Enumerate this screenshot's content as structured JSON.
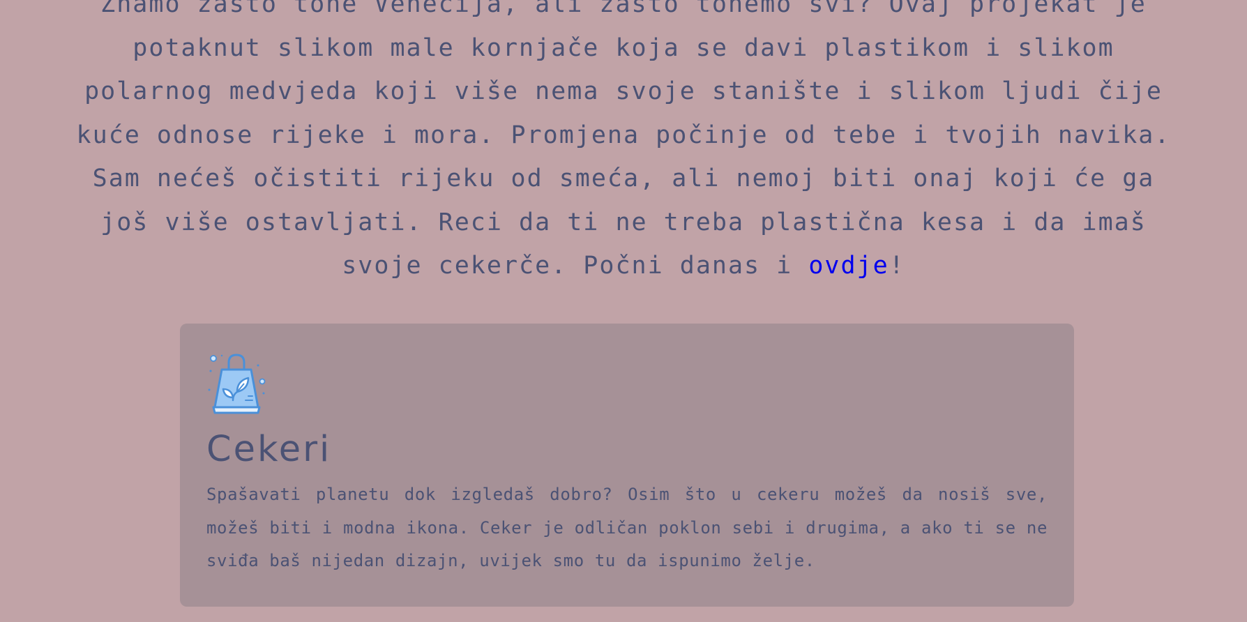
{
  "intro": {
    "text_before_link": "Znamo zašto tone Venecija, ali zašto tonemo svi? Ovaj projekat je potaknut slikom male kornjače koja se davi plastikom i slikom polarnog medvjeda koji više nema svoje stanište i slikom ljudi čije kuće odnose rijeke i mora. Promjena počinje od tebe i tvojih navika. Sam nećeš očistiti rijeku od smeća, ali nemoj biti onaj koji će ga još više ostavljati. Reci da ti ne treba plastična kesa i da imaš svoje cekerče. Počni danas i ",
    "link_text": "ovdje",
    "text_after_link": "!"
  },
  "card": {
    "icon": "eco-shopping-bag-icon",
    "title": "Cekeri",
    "description": "Spašavati planetu dok izgledaš dobro? Osim što u cekeru možeš da nosiš sve, možeš biti i modna ikona. Ceker je odličan poklon sebi i drugima, a ako ti se ne sviđa baš nijedan dizajn, uvijek smo tu da ispunimo želje."
  },
  "colors": {
    "background": "#c1a3a7",
    "card_background": "#a69197",
    "text": "#4b5274",
    "link": "#0000ee",
    "icon_blue": "#4a90d9",
    "icon_fill": "#9cc9f5"
  }
}
